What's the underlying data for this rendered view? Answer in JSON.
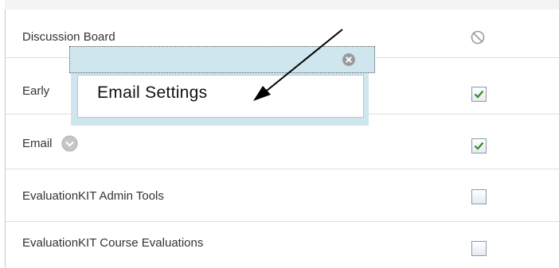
{
  "rows": [
    {
      "label": "Discussion Board",
      "status": "not-available"
    },
    {
      "label": "Early",
      "status": "checked"
    },
    {
      "label": "Email",
      "status": "checked"
    },
    {
      "label": "EvaluationKIT Admin Tools",
      "status": "unchecked"
    },
    {
      "label": "EvaluationKIT Course Evaluations",
      "status": "unchecked"
    }
  ],
  "popup": {
    "item_label": "Email Settings",
    "close_icon": "close-icon"
  },
  "icons": {
    "unavailable": "no-entry-icon",
    "options": "chevron-down-icon",
    "check": "check-icon"
  },
  "colors": {
    "popup_bg": "#cfe6ee",
    "check_green": "#2e8b2e",
    "row_border": "#dedede"
  }
}
